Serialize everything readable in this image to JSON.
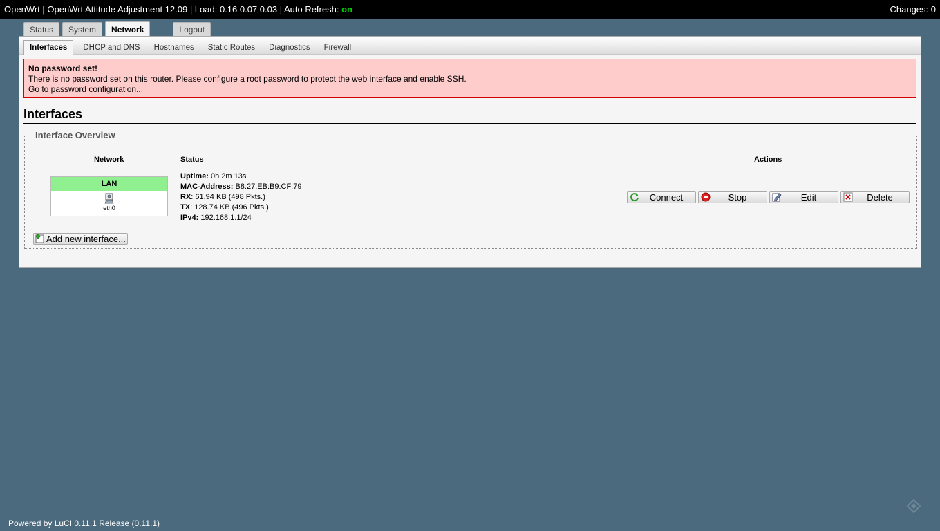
{
  "header": {
    "title": "OpenWrt | OpenWrt Attitude Adjustment 12.09 | Load: 0.16 0.07 0.03 | Auto Refresh: ",
    "auto_refresh_state": "on",
    "changes": "Changes: 0"
  },
  "top_tabs": [
    {
      "label": "Status",
      "active": false
    },
    {
      "label": "System",
      "active": false
    },
    {
      "label": "Network",
      "active": true
    },
    {
      "label": "Logout",
      "active": false
    }
  ],
  "sub_tabs": [
    {
      "label": "Interfaces",
      "active": true
    },
    {
      "label": "DHCP and DNS",
      "active": false
    },
    {
      "label": "Hostnames",
      "active": false
    },
    {
      "label": "Static Routes",
      "active": false
    },
    {
      "label": "Diagnostics",
      "active": false
    },
    {
      "label": "Firewall",
      "active": false
    }
  ],
  "alert": {
    "title": "No password set!",
    "message": "There is no password set on this router. Please configure a root password to protect the web interface and enable SSH.",
    "link": "Go to password configuration..."
  },
  "page": {
    "title": "Interfaces",
    "fieldset_legend": "Interface Overview"
  },
  "table": {
    "col_network": "Network",
    "col_status": "Status",
    "col_actions": "Actions"
  },
  "interface": {
    "name": "LAN",
    "device": "eth0",
    "uptime_label": "Uptime:",
    "uptime": " 0h 2m 13s",
    "mac_label": "MAC-Address:",
    "mac": " B8:27:EB:B9:CF:79",
    "rx_label": "RX",
    "rx": ": 61.94 KB (498 Pkts.)",
    "tx_label": "TX",
    "tx": ": 128.74 KB (496 Pkts.)",
    "ipv4_label": "IPv4:",
    "ipv4": " 192.168.1.1/24"
  },
  "actions": {
    "connect": "Connect",
    "stop": "Stop",
    "edit": "Edit",
    "delete": "Delete"
  },
  "add_interface": "Add new interface...",
  "footer": "Powered by LuCI 0.11.1 Release (0.11.1)",
  "colors": {
    "background": "#4c6a7d",
    "alert_bg": "#ffcccc",
    "alert_border": "#d20000",
    "lan_badge": "#90f090",
    "auto_refresh_on": "#00d000"
  }
}
